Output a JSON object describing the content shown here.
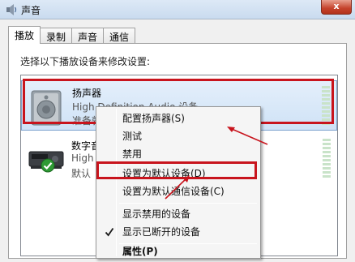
{
  "window": {
    "title": "声音",
    "close_label": "x"
  },
  "tabs": [
    {
      "label": "播放",
      "active": true
    },
    {
      "label": "录制",
      "active": false
    },
    {
      "label": "声音",
      "active": false
    },
    {
      "label": "通信",
      "active": false
    }
  ],
  "panel": {
    "instruction": "选择以下播放设备来修改设置:"
  },
  "devices": [
    {
      "name": "扬声器",
      "description": "High Definition Audio 设备",
      "status": "准备就",
      "icon": "speaker-icon",
      "selected": true
    },
    {
      "name": "数字音",
      "description": "High",
      "status": "默认",
      "icon": "digital-audio-device-icon",
      "default_badge_icon": "green-check-icon",
      "selected": false
    }
  ],
  "context_menu": {
    "items": [
      {
        "label": "配置扬声器(S)"
      },
      {
        "label": "测试"
      },
      {
        "label": "禁用"
      },
      {
        "label": "设置为默认设备(D)",
        "highlighted": true
      },
      {
        "label": "设置为默认通信设备(C)"
      },
      {
        "label": "显示禁用的设备"
      },
      {
        "label": "显示已断开的设备",
        "checked": true,
        "check_icon": "checkmark-icon"
      },
      {
        "label": "属性(P)",
        "bold": true
      }
    ]
  },
  "annotations": {
    "highlight_color": "#c8141d",
    "selection_color": "#cfe2f6"
  }
}
